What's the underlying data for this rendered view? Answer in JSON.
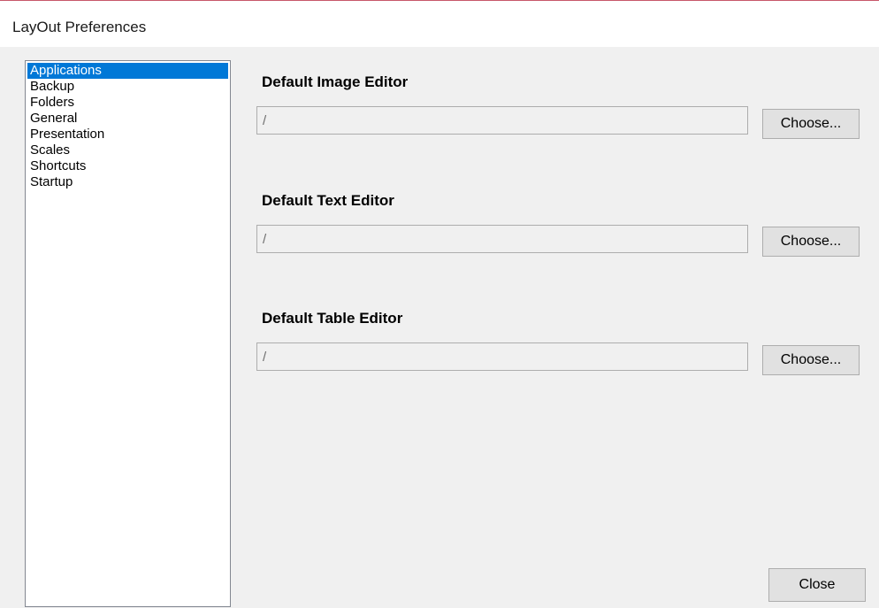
{
  "window": {
    "title": "LayOut Preferences"
  },
  "sidebar": {
    "items": [
      {
        "label": "Applications",
        "selected": true
      },
      {
        "label": "Backup",
        "selected": false
      },
      {
        "label": "Folders",
        "selected": false
      },
      {
        "label": "General",
        "selected": false
      },
      {
        "label": "Presentation",
        "selected": false
      },
      {
        "label": "Scales",
        "selected": false
      },
      {
        "label": "Shortcuts",
        "selected": false
      },
      {
        "label": "Startup",
        "selected": false
      }
    ]
  },
  "sections": {
    "image_editor": {
      "heading": "Default Image Editor",
      "path_value": "/",
      "choose_label": "Choose..."
    },
    "text_editor": {
      "heading": "Default Text Editor",
      "path_value": "/",
      "choose_label": "Choose..."
    },
    "table_editor": {
      "heading": "Default Table Editor",
      "path_value": "/",
      "choose_label": "Choose..."
    }
  },
  "footer": {
    "close_label": "Close"
  },
  "colors": {
    "selection": "#0078d7",
    "dialog_background": "#f0f0f0",
    "title_accent": "#c8586a"
  }
}
